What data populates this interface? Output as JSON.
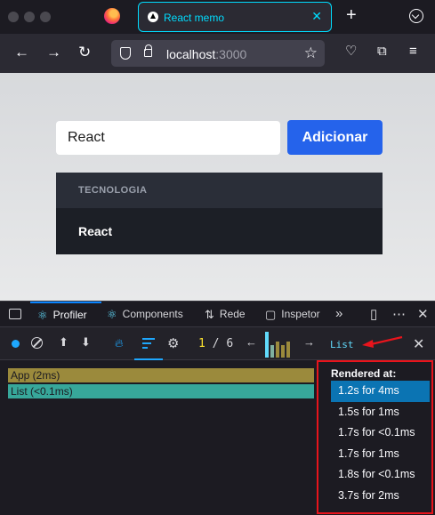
{
  "browser": {
    "tab_title": "React memo",
    "url_host": "localhost",
    "url_port": ":3000"
  },
  "app": {
    "input_value": "React",
    "add_button": "Adicionar",
    "list_header": "TECNOLOGIA",
    "items": [
      "React"
    ]
  },
  "devtools": {
    "tabs": {
      "profiler": "Profiler",
      "components": "Components",
      "network": "Rede",
      "inspector": "Inspetor"
    },
    "commit_current": "1",
    "commit_sep": " / ",
    "commit_total": "6",
    "filter_label": "List",
    "flame_nodes": [
      "App (2ms)",
      "List (<0.1ms)"
    ],
    "sidebar_title": "Rendered at:",
    "renders": [
      "1.2s for 4ms",
      "1.5s for 1ms",
      "1.7s for <0.1ms",
      "1.7s for 1ms",
      "1.8s for <0.1ms",
      "3.7s for 2ms"
    ],
    "commit_bars": [
      {
        "value": 0.9,
        "color": "#61dafb"
      },
      {
        "value": 0.45,
        "color": "#7fb0a0"
      },
      {
        "value": 0.55,
        "color": "#9b8a3c"
      },
      {
        "value": 0.45,
        "color": "#9b8a3c"
      },
      {
        "value": 0.55,
        "color": "#9b8a3c"
      }
    ]
  },
  "colors": {
    "accent": "#2563eb",
    "devtools_highlight": "#1ea7fd",
    "annotation": "#e8141c"
  }
}
